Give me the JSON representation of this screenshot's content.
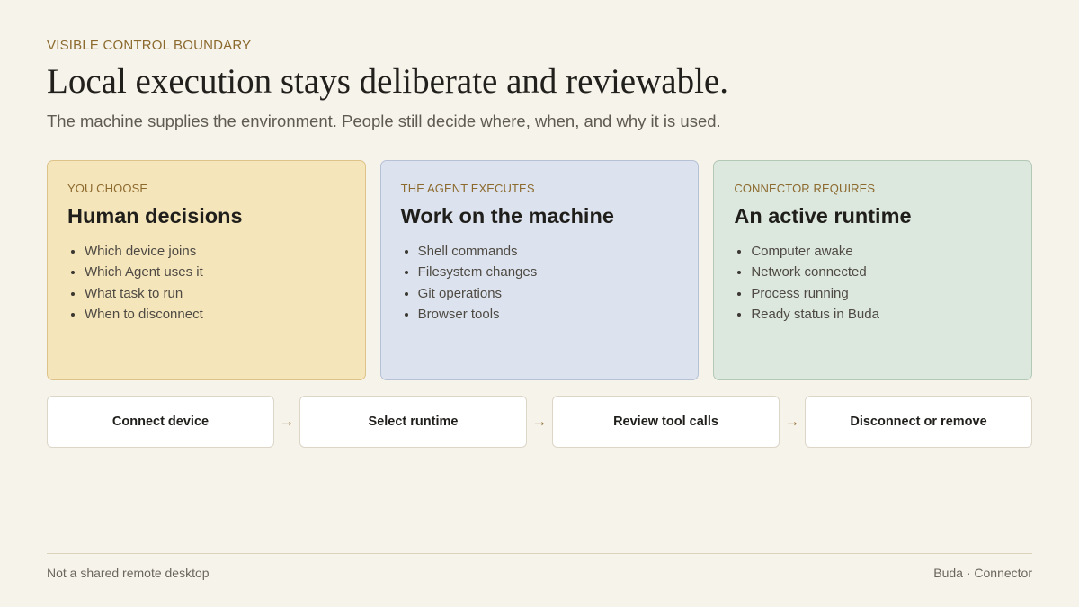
{
  "eyebrow": "VISIBLE CONTROL BOUNDARY",
  "headline": "Local execution stays deliberate and reviewable.",
  "subtitle": "The machine supplies the environment. People still decide where, when, and why it is used.",
  "cards": [
    {
      "tag": "YOU CHOOSE",
      "title": "Human decisions",
      "color": "#f5e5bb",
      "items": [
        "Which device joins",
        "Which Agent uses it",
        "What task to run",
        "When to disconnect"
      ]
    },
    {
      "tag": "THE AGENT EXECUTES",
      "title": "Work on the machine",
      "color": "#dde3ee",
      "items": [
        "Shell commands",
        "Filesystem changes",
        "Git operations",
        "Browser tools"
      ]
    },
    {
      "tag": "CONNECTOR REQUIRES",
      "title": "An active runtime",
      "color": "#dce7dd",
      "items": [
        "Computer awake",
        "Network connected",
        "Process running",
        "Ready status in Buda"
      ]
    }
  ],
  "steps": [
    "Connect device",
    "Select runtime",
    "Review tool calls",
    "Disconnect or remove"
  ],
  "step_separator": "→",
  "footer": {
    "left": "Not a shared remote desktop",
    "right": "Buda · Connector"
  },
  "colors": {
    "background": "#f6f3eb",
    "accent": "#8c6a2e"
  }
}
